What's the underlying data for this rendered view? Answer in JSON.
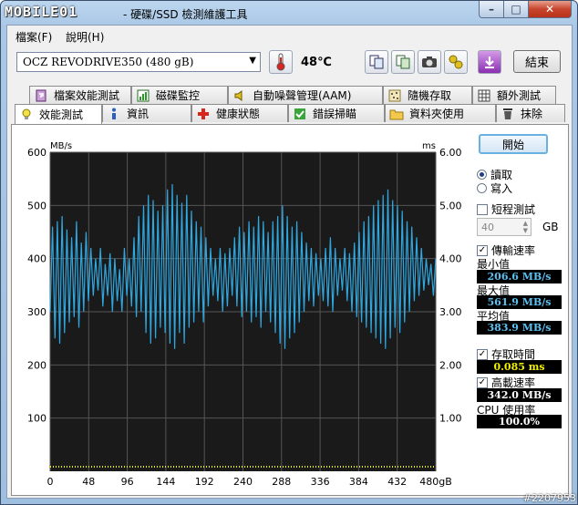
{
  "window": {
    "logo": "MOBILE01",
    "title": "- 硬碟/SSD 檢測維護工具"
  },
  "menu": [
    {
      "label": "檔案(F)"
    },
    {
      "label": "說明(H)"
    }
  ],
  "toolbar": {
    "drive": "OCZ    REVODRIVE350 (480 gB)",
    "temperature": "48℃",
    "exit_label": "結束"
  },
  "tabs_back": [
    {
      "label": "檔案效能測試"
    },
    {
      "label": "磁碟監控"
    },
    {
      "label": "自動噪聲管理(AAM)"
    },
    {
      "label": "隨機存取"
    },
    {
      "label": "額外測試"
    }
  ],
  "tabs_front": [
    {
      "label": "效能測試"
    },
    {
      "label": "資訊"
    },
    {
      "label": "健康狀態"
    },
    {
      "label": "錯誤掃瞄"
    },
    {
      "label": "資料夾使用"
    },
    {
      "label": "抹除"
    }
  ],
  "side": {
    "start_label": "開始",
    "read_label": "讀取",
    "write_label": "寫入",
    "short_test_label": "短程測試",
    "size_value": "40",
    "size_unit": "GB",
    "transfer_label": "傳輸速率",
    "min_label": "最小值",
    "min_value": "206.6 MB/s",
    "max_label": "最大值",
    "max_value": "561.9 MB/s",
    "avg_label": "平均值",
    "avg_value": "383.9 MB/s",
    "access_label": "存取時間",
    "access_value": "0.085 ms",
    "burst_label": "高載速率",
    "burst_value": "342.0 MB/s",
    "cpu_label": "CPU 使用率",
    "cpu_value": "100.0%"
  },
  "watermark": "#2207953",
  "chart_data": {
    "type": "line",
    "ylabel": "MB/s",
    "y2label": "ms",
    "ylim": [
      0,
      600
    ],
    "y2lim": [
      0,
      6
    ],
    "yticks": [
      "600",
      "500",
      "400",
      "300",
      "200",
      "100"
    ],
    "y2ticks": [
      "6.00",
      "5.00",
      "4.00",
      "3.00",
      "2.00",
      "1.00"
    ],
    "xlim": [
      0,
      480
    ],
    "xticks": [
      "0",
      "48",
      "96",
      "144",
      "192",
      "240",
      "288",
      "336",
      "384",
      "432",
      "480gB"
    ],
    "colors": {
      "transfer": "#2fa7e0",
      "access": "#e8e800",
      "background": "#1a1a1a",
      "grid": "#555555"
    },
    "series": [
      {
        "key": "transfer",
        "values": [
          300,
          460,
          250,
          470,
          240,
          480,
          260,
          455,
          280,
          440,
          290,
          470,
          270,
          430,
          300,
          450,
          320,
          420,
          330,
          400,
          340,
          420,
          310,
          390,
          330,
          410,
          300,
          400,
          320,
          380,
          300,
          420,
          330,
          400,
          310,
          440,
          290,
          480,
          300,
          500,
          260,
          520,
          240,
          510,
          250,
          490,
          270,
          500,
          260,
          530,
          240,
          540,
          230,
          520,
          260,
          505,
          240,
          520,
          270,
          490,
          280,
          470,
          300,
          460,
          280,
          440,
          310,
          420,
          330,
          400,
          320,
          420,
          300,
          410,
          310,
          420,
          330,
          440,
          310,
          460,
          290,
          450,
          300,
          470,
          280,
          460,
          290,
          480,
          270,
          470,
          300,
          450,
          280,
          470,
          260,
          480,
          240,
          500,
          230,
          480,
          250,
          460,
          260,
          470,
          280,
          450,
          300,
          430,
          320,
          420,
          310,
          410,
          330,
          400,
          320,
          420,
          310,
          440,
          300,
          420,
          330,
          400,
          340,
          420,
          320,
          410,
          300,
          430,
          290,
          450,
          280,
          470,
          270,
          480,
          260,
          500,
          250,
          510,
          240,
          520,
          230,
          530,
          250,
          510,
          270,
          500,
          260,
          490,
          280,
          470,
          300,
          460,
          320,
          440,
          330,
          420,
          340,
          400,
          350,
          390,
          330,
          400
        ]
      },
      {
        "key": "access",
        "value": 0.085
      }
    ]
  }
}
